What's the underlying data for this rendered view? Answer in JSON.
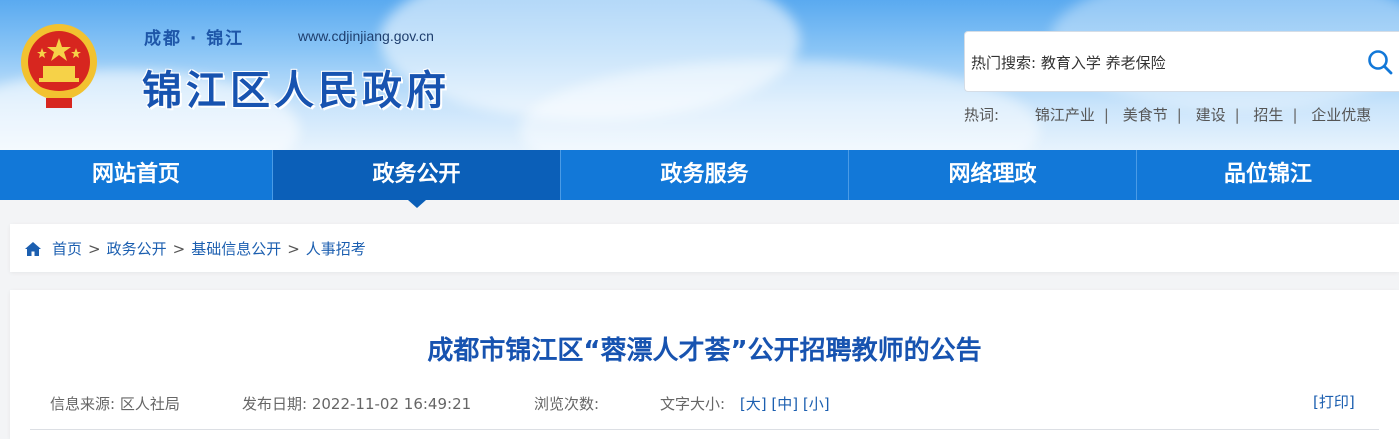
{
  "header": {
    "city_line": "成都 · 锦江",
    "domain": "www.cdjinjiang.gov.cn",
    "site_title": "锦江区人民政府",
    "emblem_icon": "national-emblem-icon"
  },
  "search": {
    "label": "热门搜索:",
    "suggestions": "教育入学 养老保险",
    "icon": "search-icon"
  },
  "hot_words": {
    "label": "热词:",
    "items": [
      "锦江产业",
      "美食节",
      "建设",
      "招生",
      "企业优惠"
    ]
  },
  "nav": {
    "items": [
      {
        "label": "网站首页"
      },
      {
        "label": "政务公开"
      },
      {
        "label": "政务服务"
      },
      {
        "label": "网络理政"
      },
      {
        "label": "品位锦江"
      }
    ],
    "active": "政务公开",
    "color": "#1278d8",
    "active_color": "#0b5fb8"
  },
  "breadcrumb": {
    "icon": "home-icon",
    "items": [
      "首页",
      "政务公开",
      "基础信息公开",
      "人事招考"
    ],
    "separator": ">"
  },
  "article": {
    "title": "成都市锦江区“蓉漂人才荟”公开招聘教师的公告",
    "source_label": "信息来源:",
    "source_value": "区人社局",
    "date_label": "发布日期:",
    "date_value": "2022-11-02 16:49:21",
    "views_label": "浏览次数:",
    "views_value": "",
    "font_size_label": "文字大小:",
    "font_large": "[大]",
    "font_medium": "[中]",
    "font_small": "[小]",
    "print": "[打印]"
  }
}
